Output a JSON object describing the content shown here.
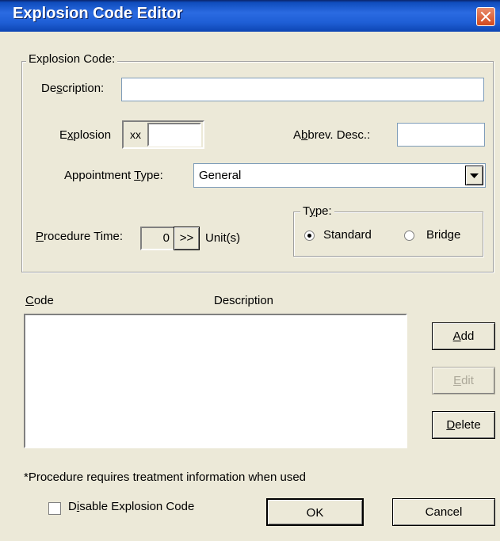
{
  "window": {
    "title": "Explosion Code Editor"
  },
  "explosion_group": {
    "legend": "Explosion Code:",
    "description_label_pre": "De",
    "description_label_ul": "s",
    "description_label_post": "cription:",
    "description_value": "",
    "explosion_label_pre": "E",
    "explosion_label_ul": "x",
    "explosion_label_post": "plosion",
    "explosion_prefix": "xx",
    "explosion_value": "",
    "abbrev_label_pre": "A",
    "abbrev_label_ul": "b",
    "abbrev_label_post": "brev. Desc.:",
    "abbrev_value": "",
    "appt_label_pre": "Appointment ",
    "appt_label_ul": "T",
    "appt_label_post": "ype:",
    "appt_value": "General",
    "proc_label_ul": "P",
    "proc_label_post": "rocedure Time:",
    "proc_value": "0",
    "proc_button": ">>",
    "proc_units": "Unit(s)",
    "type_legend_pre": "T",
    "type_legend_ul": "y",
    "type_legend_post": "pe:",
    "type_standard": "Standard",
    "type_bridge": "Bridge"
  },
  "list": {
    "col_code_ul": "C",
    "col_code_post": "ode",
    "col_description": "Description",
    "rows": []
  },
  "buttons": {
    "add_ul": "A",
    "add_post": "dd",
    "edit_ul": "E",
    "edit_post": "dit",
    "delete_ul": "D",
    "delete_post": "elete",
    "ok": "OK",
    "cancel": "Cancel"
  },
  "footer": {
    "note": "*Procedure requires treatment information when used",
    "disable_pre": "D",
    "disable_ul": "i",
    "disable_post": "sable Explosion Code"
  }
}
